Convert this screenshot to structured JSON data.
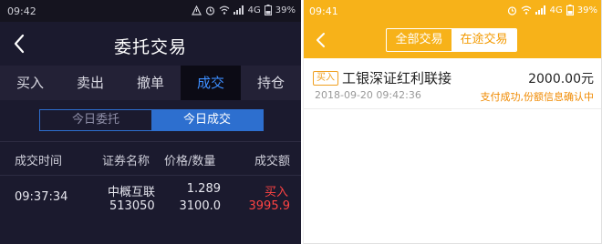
{
  "left": {
    "status_bar": {
      "time": "09:42",
      "network": "4G",
      "battery": "39%"
    },
    "title": "委托交易",
    "tabs": [
      "买入",
      "卖出",
      "撤单",
      "成交",
      "持仓"
    ],
    "active_tab": 3,
    "segments": [
      "今日委托",
      "今日成交"
    ],
    "active_segment": 1,
    "columns": [
      "成交时间",
      "证券名称",
      "价格/数量",
      "成交额"
    ],
    "rows": [
      {
        "time": "09:37:34",
        "name": "中概互联",
        "code": "513050",
        "price": "1.289",
        "quantity": "3100.0",
        "side": "买入",
        "amount": "3995.9"
      }
    ]
  },
  "right": {
    "status_bar": {
      "time": "09:41",
      "network": "4G",
      "battery": "39%"
    },
    "segments": [
      "全部交易",
      "在途交易"
    ],
    "active_segment": 1,
    "items": [
      {
        "badge": "买入",
        "name": "工银深证红利联接",
        "amount": "2000.00元",
        "timestamp": "2018-09-20 09:42:36",
        "status": "支付成功,份额信息确认中"
      }
    ]
  },
  "colors": {
    "left_bg": "#1b1a2e",
    "accent_blue": "#2d6fcf",
    "sell_red": "#ff4343",
    "right_orange": "#f7b219",
    "status_orange": "#f08a00"
  }
}
